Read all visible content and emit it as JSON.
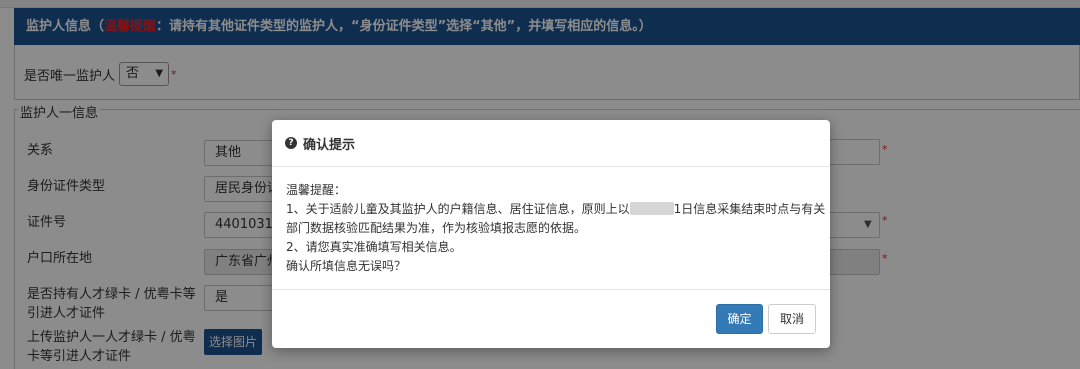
{
  "header": {
    "prefix": "监护人信息（",
    "highlight": "温馨提醒",
    "suffix": "：请持有其他证件类型的监护人，“身份证件类型”选择“其他”，并填写相应的信息。）"
  },
  "only_guardian": {
    "label": "是否唯一监护人",
    "value": "否",
    "required_mark": "*"
  },
  "section_legend": "监护人一信息",
  "form": {
    "relation_label": "关系",
    "relation_value": "其他",
    "id_type_label": "身份证件类型",
    "id_type_value": "居民身份证",
    "id_no_label": "证件号",
    "id_no_value": "4401031",
    "hukou_label": "户口所在地",
    "hukou_value": "广东省广州",
    "talent_label_1": "是否持有人才绿卡 / 优粤卡等",
    "talent_label_2": "引进人才证件",
    "talent_value": "是",
    "upload_label_1": "上传监护人一人才绿卡 / 优粤",
    "upload_label_2": "卡等引进人才证件",
    "upload_button": "选择图片",
    "required_mark": "*"
  },
  "modal": {
    "title": "确认提示",
    "line1": "温馨提醒：",
    "line2a": "1、关于适龄儿童及其监护人的户籍信息、居住证信息，原则上以",
    "line2b": "1日信息采集结束时点与有关",
    "line3": "部门数据核验匹配结果为准，作为核验填报志愿的依据。",
    "line4": "2、请您真实准确填写相关信息。",
    "line5": "确认所填信息无误吗？",
    "ok_label": "确定",
    "cancel_label": "取消"
  },
  "colors": {
    "header_bg": "#1d5290",
    "highlight": "#e6262b",
    "primary_button": "#337ab7"
  },
  "icons": {
    "modal_title_icon": "question-circle-icon",
    "select_arrow": "chevron-down-icon"
  }
}
